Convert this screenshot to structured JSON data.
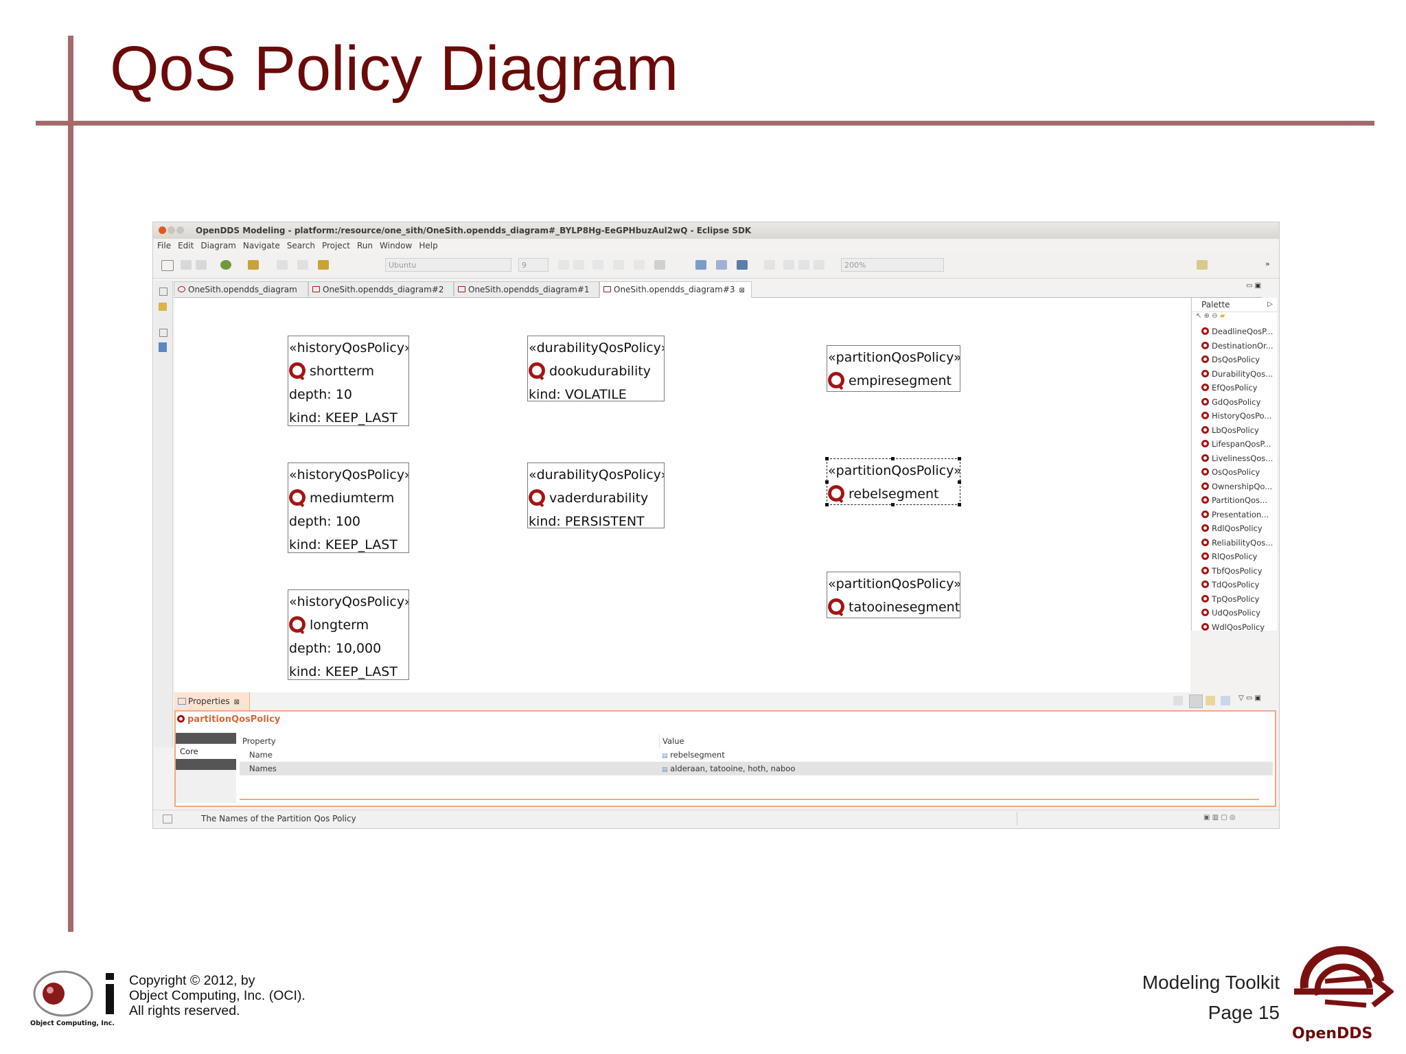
{
  "slide": {
    "title": "QoS Policy Diagram",
    "copyright_lines": [
      "Copyright © 2012, by",
      "Object Computing, Inc. (OCI).",
      "All rights reserved."
    ],
    "oci_logo_text": "Object Computing, Inc.",
    "toolkit_label": "Modeling Toolkit",
    "page_label": "Page 15",
    "opendds_logo_text": "OpenDDS"
  },
  "window": {
    "title": "OpenDDS Modeling - platform:/resource/one_sith/OneSith.opendds_diagram#_BYLP8Hg-EeGPHbuzAul2wQ - Eclipse SDK",
    "menu": [
      "File",
      "Edit",
      "Diagram",
      "Navigate",
      "Search",
      "Project",
      "Run",
      "Window",
      "Help"
    ],
    "font_combo": "Ubuntu",
    "size_combo": "9",
    "zoom_combo": "200%",
    "tabs": [
      "OneSith.opendds_diagram",
      "OneSith.opendds_diagram#2",
      "OneSith.opendds_diagram#1",
      "OneSith.opendds_diagram#3"
    ]
  },
  "nodes": [
    {
      "stereotype": "«historyQosPolicy»",
      "name": "shortterm",
      "lines": [
        "depth: 10",
        "kind: KEEP_LAST"
      ]
    },
    {
      "stereotype": "«historyQosPolicy»",
      "name": "mediumterm",
      "lines": [
        "depth: 100",
        "kind: KEEP_LAST"
      ]
    },
    {
      "stereotype": "«historyQosPolicy»",
      "name": "longterm",
      "lines": [
        "depth: 10,000",
        "kind: KEEP_LAST"
      ]
    },
    {
      "stereotype": "«durabilityQosPolicy»",
      "name": "dookudurability",
      "lines": [
        "kind: VOLATILE"
      ]
    },
    {
      "stereotype": "«durabilityQosPolicy»",
      "name": "vaderdurability",
      "lines": [
        "kind: PERSISTENT"
      ]
    },
    {
      "stereotype": "«partitionQosPolicy»",
      "name": "empiresegment",
      "lines": []
    },
    {
      "stereotype": "«partitionQosPolicy»",
      "name": "rebelsegment",
      "lines": []
    },
    {
      "stereotype": "«partitionQosPolicy»",
      "name": "tatooinesegment",
      "lines": []
    }
  ],
  "palette": {
    "title": "Palette",
    "items": [
      "DeadlineQosP...",
      "DestinationOr...",
      "DsQosPolicy",
      "DurabilityQos...",
      "EfQosPolicy",
      "GdQosPolicy",
      "HistoryQosPo...",
      "LbQosPolicy",
      "LifespanQosP...",
      "LivelinessQos...",
      "OsQosPolicy",
      "OwnershipQo...",
      "PartitionQos...",
      "Presentation...",
      "RdlQosPolicy",
      "ReliabilityQos...",
      "RlQosPolicy",
      "TbfQosPolicy",
      "TdQosPolicy",
      "TpQosPolicy",
      "UdQosPolicy",
      "WdlQosPolicy"
    ]
  },
  "properties": {
    "tab_label": "Properties",
    "selection_label": "partitionQosPolicy",
    "category": "Core",
    "columns": [
      "Property",
      "Value"
    ],
    "rows": [
      {
        "property": "Name",
        "value": "rebelsegment"
      },
      {
        "property": "Names",
        "value": "alderaan, tatooine, hoth, naboo"
      }
    ]
  },
  "status": {
    "text": "The Names of the Partition Qos Policy"
  },
  "colors": {
    "title": "#6b0a0a",
    "rule": "#a36a6a",
    "qos_icon": "#a31515",
    "properties_accent": "#f0a882"
  }
}
